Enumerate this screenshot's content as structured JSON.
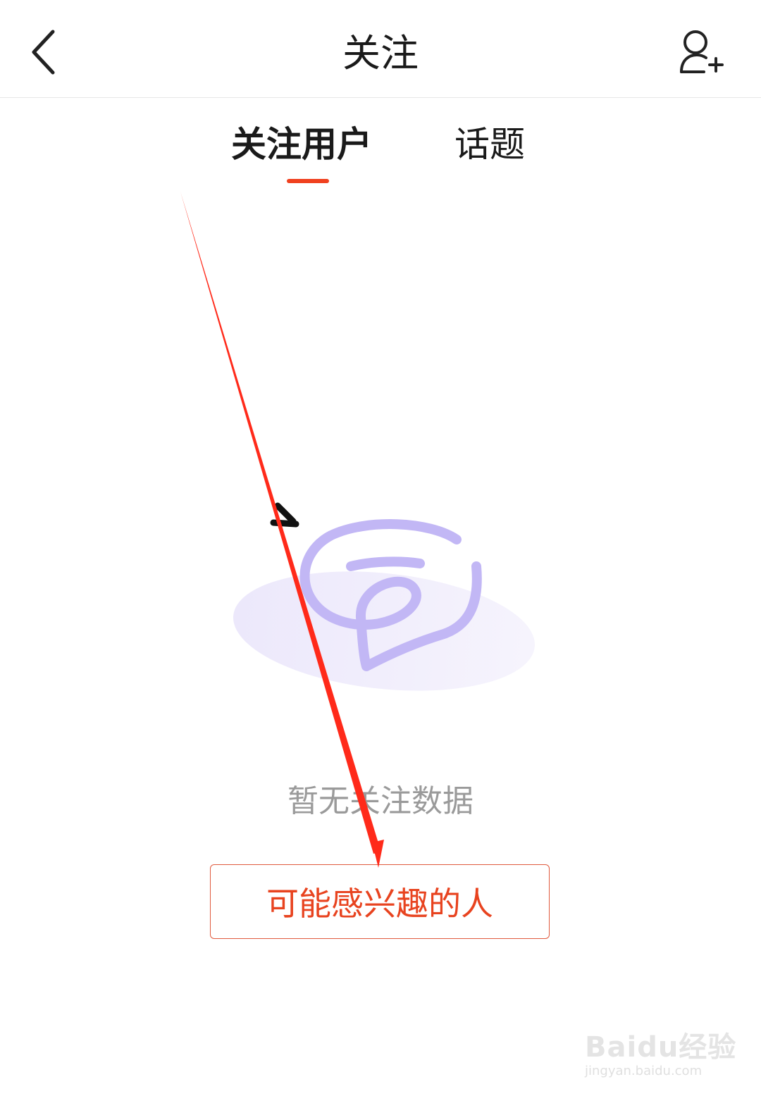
{
  "header": {
    "title": "关注",
    "back_icon": "chevron-left-icon",
    "add_user_icon": "add-user-icon"
  },
  "tabs": [
    {
      "label": "关注用户",
      "active": true
    },
    {
      "label": "话题",
      "active": false
    }
  ],
  "empty_state": {
    "illustration_icon": "empty-chat-icon",
    "message": "暂无关注数据"
  },
  "suggest_button": {
    "label": "可能感兴趣的人"
  },
  "watermark": {
    "logo_text": "Baidu经验",
    "url": "jingyan.baidu.com"
  },
  "colors": {
    "accent": "#f0411f",
    "illustration": "#c2b7f5",
    "annotation": "#ff2a1a"
  }
}
